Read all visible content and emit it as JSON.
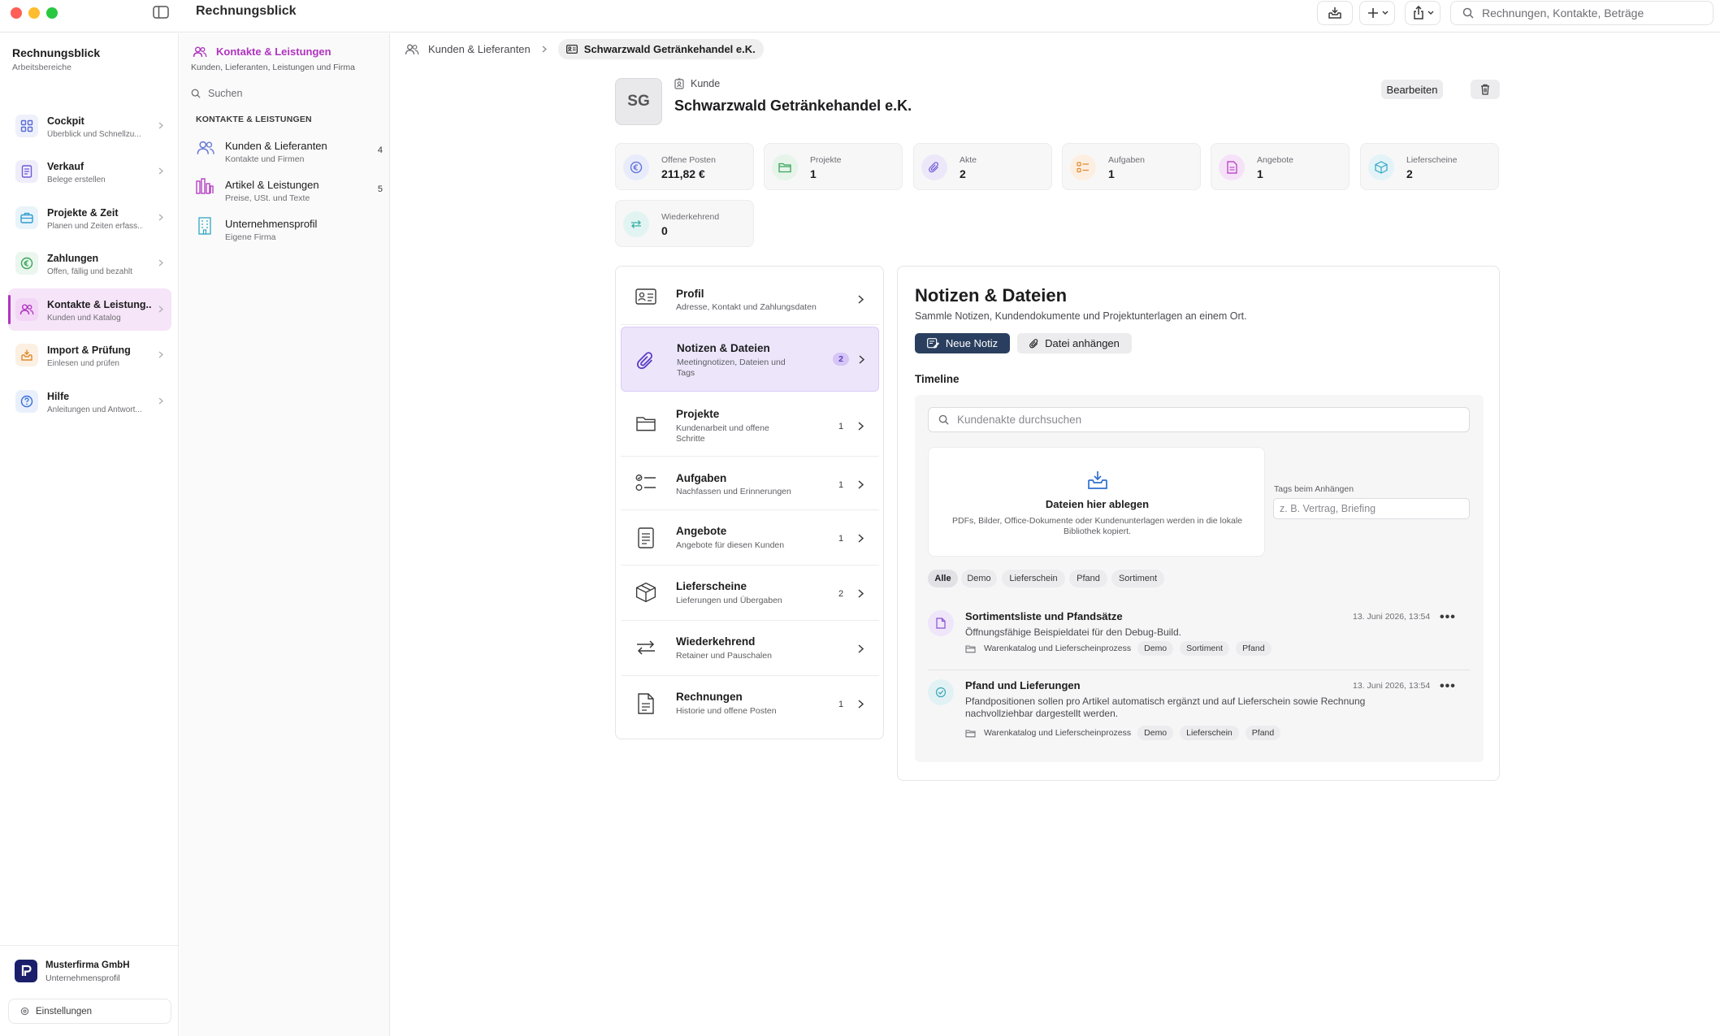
{
  "app": {
    "title": "Rechnungsblick"
  },
  "toolbar": {
    "search_placeholder": "Rechnungen, Kontakte, Beträge"
  },
  "sidebar": {
    "title": "Rechnungsblick",
    "subtitle": "Arbeitsbereiche",
    "items": [
      {
        "label": "Cockpit",
        "sub": "Überblick und Schnellzu...",
        "icon": "grid-icon",
        "color": "#5b6bd8"
      },
      {
        "label": "Verkauf",
        "sub": "Belege erstellen",
        "icon": "document-icon",
        "color": "#6d5ad6"
      },
      {
        "label": "Projekte & Zeit",
        "sub": "Planen und Zeiten erfass...",
        "icon": "briefcase-icon",
        "color": "#2f9bd0"
      },
      {
        "label": "Zahlungen",
        "sub": "Offen, fällig und bezahlt",
        "icon": "euro-icon",
        "color": "#3aa55a"
      },
      {
        "label": "Kontakte & Leistung...",
        "sub": "Kunden und Katalog",
        "icon": "people-icon",
        "color": "#b034c0"
      },
      {
        "label": "Import & Prüfung",
        "sub": "Einlesen und prüfen",
        "icon": "inbox-icon",
        "color": "#e08a2e"
      },
      {
        "label": "Hilfe",
        "sub": "Anleitungen und Antwort...",
        "icon": "question-icon",
        "color": "#3b6fd8"
      }
    ],
    "company": {
      "name": "Musterfirma GmbH",
      "sub": "Unternehmensprofil"
    },
    "settings_label": "Einstellungen"
  },
  "col2": {
    "title": "Kontakte & Leistungen",
    "subtitle": "Kunden, Lieferanten, Leistungen und Firma",
    "search_placeholder": "Suchen",
    "section_header": "KONTAKTE & LEISTUNGEN",
    "items": [
      {
        "label": "Kunden & Lieferanten",
        "sub": "Kontakte und Firmen",
        "count": "4"
      },
      {
        "label": "Artikel & Leistungen",
        "sub": "Preise, USt. und Texte",
        "count": "5"
      },
      {
        "label": "Unternehmensprofil",
        "sub": "Eigene Firma",
        "count": ""
      }
    ]
  },
  "breadcrumb": {
    "parent": "Kunden & Lieferanten",
    "current": "Schwarzwald Getränkehandel e.K."
  },
  "customer": {
    "initials": "SG",
    "kind": "Kunde",
    "name": "Schwarzwald Getränkehandel e.K.",
    "edit_label": "Bearbeiten"
  },
  "stats": [
    {
      "label": "Offene Posten",
      "value": "211,82 €",
      "icon": "euro-icon",
      "color": "#5b6bd8"
    },
    {
      "label": "Projekte",
      "value": "1",
      "icon": "folder-icon",
      "color": "#3aa55a"
    },
    {
      "label": "Akte",
      "value": "2",
      "icon": "paperclip-icon",
      "color": "#6d5ad6"
    },
    {
      "label": "Aufgaben",
      "value": "1",
      "icon": "checklist-icon",
      "color": "#e08a2e"
    },
    {
      "label": "Angebote",
      "value": "1",
      "icon": "document-icon",
      "color": "#b034c0"
    },
    {
      "label": "Lieferscheine",
      "value": "2",
      "icon": "box-icon",
      "color": "#2fa7c4"
    },
    {
      "label": "Wiederkehrend",
      "value": "0",
      "icon": "repeat-icon",
      "color": "#3ab0a8"
    }
  ],
  "sections": [
    {
      "label": "Profil",
      "sub": "Adresse, Kontakt und Zahlungsdaten",
      "count": "",
      "icon": "id-card-icon"
    },
    {
      "label": "Notizen & Dateien",
      "sub": "Meetingnotizen, Dateien und Tags",
      "count": "2",
      "icon": "paperclip-icon"
    },
    {
      "label": "Projekte",
      "sub": "Kundenarbeit und offene Schritte",
      "count": "1",
      "icon": "folder-icon"
    },
    {
      "label": "Aufgaben",
      "sub": "Nachfassen und Erinnerungen",
      "count": "1",
      "icon": "checklist-icon"
    },
    {
      "label": "Angebote",
      "sub": "Angebote für diesen Kunden",
      "count": "1",
      "icon": "document-icon"
    },
    {
      "label": "Lieferscheine",
      "sub": "Lieferungen und Übergaben",
      "count": "2",
      "icon": "box-icon"
    },
    {
      "label": "Wiederkehrend",
      "sub": "Retainer und Pauschalen",
      "count": "",
      "icon": "repeat-icon"
    },
    {
      "label": "Rechnungen",
      "sub": "Historie und offene Posten",
      "count": "1",
      "icon": "invoice-icon"
    }
  ],
  "notes": {
    "title": "Notizen & Dateien",
    "description": "Sammle Notizen, Kundendokumente und Projektunterlagen an einem Ort.",
    "new_note_label": "Neue Notiz",
    "attach_label": "Datei anhängen",
    "timeline_label": "Timeline",
    "search_placeholder": "Kundenakte durchsuchen",
    "drop_title": "Dateien hier ablegen",
    "drop_desc": "PDFs, Bilder, Office-Dokumente oder Kundenunterlagen werden in die lokale Bibliothek kopiert.",
    "tags_label": "Tags beim Anhängen",
    "tags_placeholder": "z. B. Vertrag, Briefing",
    "filters": [
      "Alle",
      "Demo",
      "Lieferschein",
      "Pfand",
      "Sortiment"
    ],
    "entries": [
      {
        "title": "Sortimentsliste und Pfandsätze",
        "desc": "Öffnungsfähige Beispieldatei für den Debug-Build.",
        "date": "13. Juni 2026, 13:54",
        "project": "Warenkatalog und Lieferscheinprozess",
        "tags": [
          "Demo",
          "Sortiment",
          "Pfand"
        ],
        "icon": "file-icon"
      },
      {
        "title": "Pfand und Lieferungen",
        "desc": "Pfandpositionen sollen pro Artikel automatisch ergänzt und auf Lieferschein sowie Rechnung nachvollziehbar dargestellt werden.",
        "date": "13. Juni 2026, 13:54",
        "project": "Warenkatalog und Lieferscheinprozess",
        "tags": [
          "Demo",
          "Lieferschein",
          "Pfand"
        ],
        "icon": "check-circle-icon"
      }
    ]
  }
}
